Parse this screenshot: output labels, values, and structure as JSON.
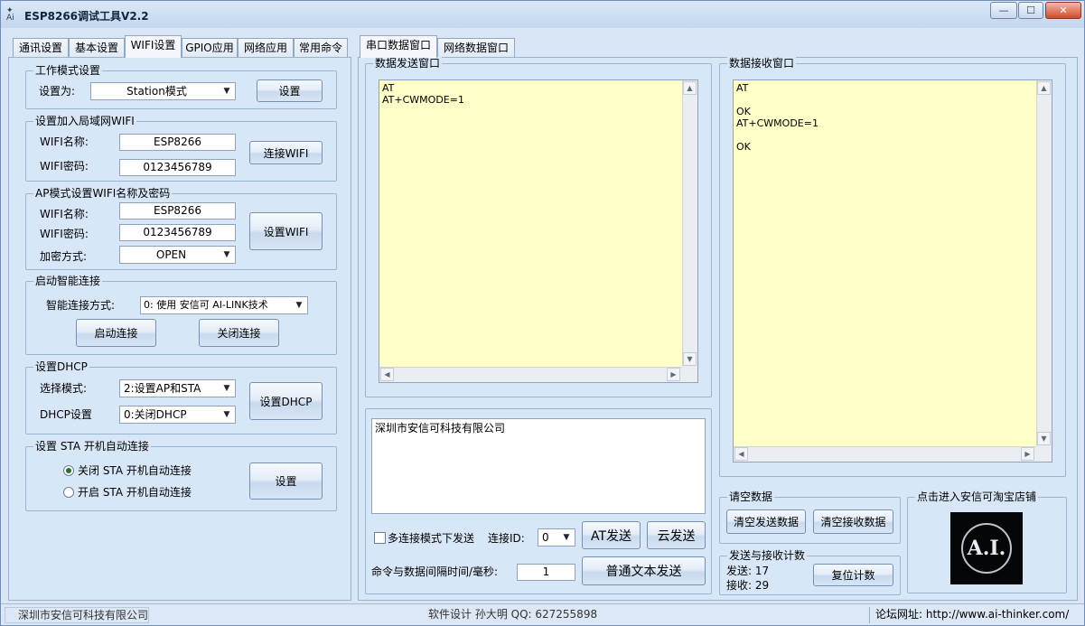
{
  "window": {
    "title": "ESP8266调试工具V2.2",
    "min": "—",
    "max": "☐",
    "close": "✕"
  },
  "left_tabs": [
    "通讯设置",
    "基本设置",
    "WIFI设置",
    "GPIO应用",
    "网络应用",
    "常用命令"
  ],
  "right_tabs": [
    "串口数据窗口",
    "网络数据窗口"
  ],
  "work_mode": {
    "group": "工作模式设置",
    "label": "设置为:",
    "value": "Station模式",
    "button": "设置"
  },
  "lan_wifi": {
    "group": "设置加入局域网WIFI",
    "name_label": "WIFI名称:",
    "name_value": "ESP8266",
    "pwd_label": "WIFI密码:",
    "pwd_value": "0123456789",
    "button": "连接WIFI"
  },
  "ap_mode": {
    "group": "AP模式设置WIFI名称及密码",
    "name_label": "WIFI名称:",
    "name_value": "ESP8266",
    "pwd_label": "WIFI密码:",
    "pwd_value": "0123456789",
    "enc_label": "加密方式:",
    "enc_value": "OPEN",
    "button": "设置WIFI"
  },
  "smart": {
    "group": "启动智能连接",
    "label": "智能连接方式:",
    "value": "0: 使用 安信可 AI-LINK技术",
    "start": "启动连接",
    "stop": "关闭连接"
  },
  "dhcp": {
    "group": "设置DHCP",
    "mode_label": "选择模式:",
    "mode_value": "2:设置AP和STA",
    "set_label": "DHCP设置",
    "set_value": "0:关闭DHCP",
    "button": "设置DHCP"
  },
  "sta_auto": {
    "group": "设置 STA 开机自动连接",
    "off": "关闭 STA 开机自动连接",
    "on": "开启 STA 开机自动连接",
    "button": "设置"
  },
  "send_window": {
    "group": "数据发送窗口",
    "content": "AT\nAT+CWMODE=1"
  },
  "recv_window": {
    "group": "数据接收窗口",
    "content": "AT\n\nOK\nAT+CWMODE=1\n\nOK"
  },
  "input_box": {
    "content": "深圳市安信可科技有限公司"
  },
  "send_controls": {
    "multi_label": "多连接模式下发送",
    "conn_id_label": "连接ID:",
    "conn_id_value": "0",
    "at_send": "AT发送",
    "cloud_send": "云发送",
    "interval_label": "命令与数据间隔时间/毫秒:",
    "interval_value": "1",
    "text_send": "普通文本发送"
  },
  "clear": {
    "group": "请空数据",
    "clear_send": "清空发送数据",
    "clear_recv": "清空接收数据"
  },
  "counter": {
    "group": "发送与接收计数",
    "sent": "发送: 17",
    "received": "接收: 29",
    "reset": "复位计数"
  },
  "shop": {
    "group": "点击进入安信可淘宝店铺",
    "logo_text": "A.I."
  },
  "status": {
    "company": "深圳市安信可科技有限公司",
    "author": "软件设计 孙大明 QQ: 627255898",
    "forum": "论坛网址: http://www.ai-thinker.com/"
  },
  "colors": {
    "window_bg": "#d9e6f5",
    "text_area_yellow": "#ffffc8",
    "logo_bg": "#050608"
  }
}
